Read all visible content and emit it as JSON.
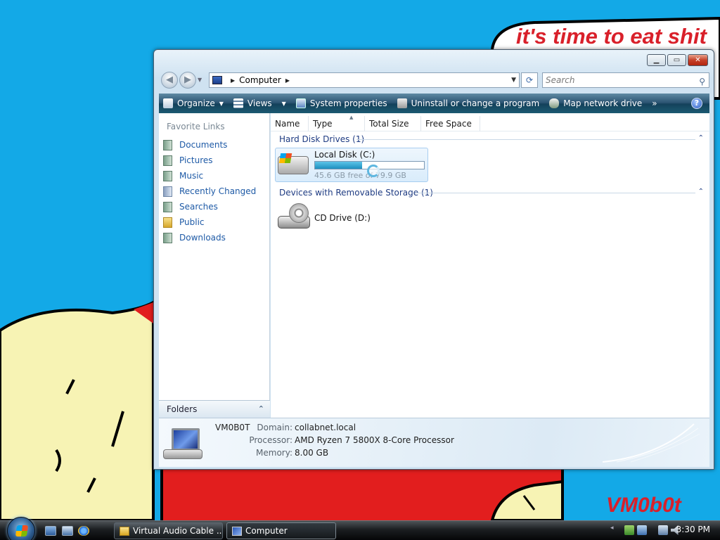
{
  "wallpaper": {
    "caption": "it's time to eat shit",
    "signature": "VM0b0t",
    "caption_color": "#d9202a",
    "background_color": "#13a9e7"
  },
  "window": {
    "caption_buttons": {
      "minimize": "▁",
      "maximize": "▭",
      "close": "✕"
    },
    "nav": {
      "back": "◀",
      "forward": "▶",
      "dropdown": "▼"
    },
    "address": {
      "separator": "▶",
      "location": "Computer",
      "trailing_separator": "▶",
      "dropdown": "▼",
      "refresh": "⟳"
    },
    "search": {
      "placeholder": "Search",
      "icon": "⚲"
    },
    "toolbar": {
      "organize": "Organize",
      "views": "Views",
      "system_properties": "System properties",
      "uninstall": "Uninstall or change a program",
      "map_network": "Map network drive",
      "more": "»",
      "help": "?",
      "arrow": "▼"
    },
    "nav_pane": {
      "heading": "Favorite Links",
      "items": [
        {
          "label": "Documents",
          "icon": "documents-icon"
        },
        {
          "label": "Pictures",
          "icon": "pictures-icon"
        },
        {
          "label": "Music",
          "icon": "music-icon"
        },
        {
          "label": "Recently Changed",
          "icon": "recently-changed-icon"
        },
        {
          "label": "Searches",
          "icon": "searches-icon"
        },
        {
          "label": "Public",
          "icon": "public-folder-icon"
        },
        {
          "label": "Downloads",
          "icon": "downloads-icon"
        }
      ],
      "folders_label": "Folders",
      "folders_chevron": "⌃"
    },
    "columns": [
      "Name",
      "Type",
      "Total Size",
      "Free Space"
    ],
    "sort_indicator": "▲",
    "groups": {
      "hdd_header": "Hard Disk Drives (1)",
      "removable_header": "Devices with Removable Storage (1)",
      "collapse": "⌃"
    },
    "drives": {
      "c": {
        "name": "Local Disk (C:)",
        "free_text": "45.6 GB free of 79.9 GB",
        "used_fraction": 0.43
      },
      "d": {
        "name": "CD Drive (D:)"
      }
    },
    "details": {
      "computer_name": "VM0B0T",
      "domain_label": "Domain:",
      "domain_value": "collabnet.local",
      "processor_label": "Processor:",
      "processor_value": "AMD Ryzen 7 5800X 8-Core Processor",
      "memory_label": "Memory:",
      "memory_value": "8.00 GB"
    }
  },
  "taskbar": {
    "buttons": [
      {
        "label": "Virtual Audio Cable ...",
        "icon": "folder-icon"
      },
      {
        "label": "Computer",
        "icon": "computer-icon"
      }
    ],
    "clock": "3:30 PM",
    "tray_chevron": "◂"
  }
}
